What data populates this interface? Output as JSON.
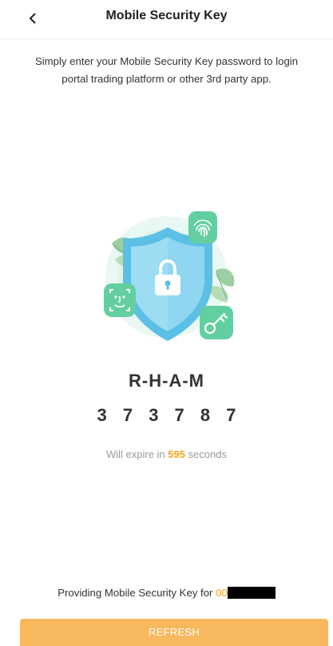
{
  "header": {
    "back_icon": "chevron-left-icon",
    "title": "Mobile Security Key"
  },
  "description": "Simply enter your Mobile Security Key password to login portal trading platform or other 3rd party app.",
  "illustration": {
    "icons": [
      "shield-icon",
      "padlock-icon",
      "fingerprint-icon",
      "face-id-icon",
      "key-icon",
      "leaf-icon"
    ],
    "colors": {
      "shield": "#5ec3e8",
      "badge": "#6cd3a8",
      "leaf": "#8cc79a",
      "halo": "#e6f7f1"
    }
  },
  "security_key": {
    "letters": "R-H-A-M",
    "digits": "373787"
  },
  "expiry": {
    "prefix": "Will expire in",
    "seconds": "595",
    "suffix": "seconds"
  },
  "footer": {
    "providing_label": "Providing Mobile Security Key for",
    "account_visible": "00"
  },
  "refresh_button": {
    "label": "REFRESH"
  },
  "colors": {
    "accent": "#f5a623",
    "button": "#f7b85e"
  }
}
